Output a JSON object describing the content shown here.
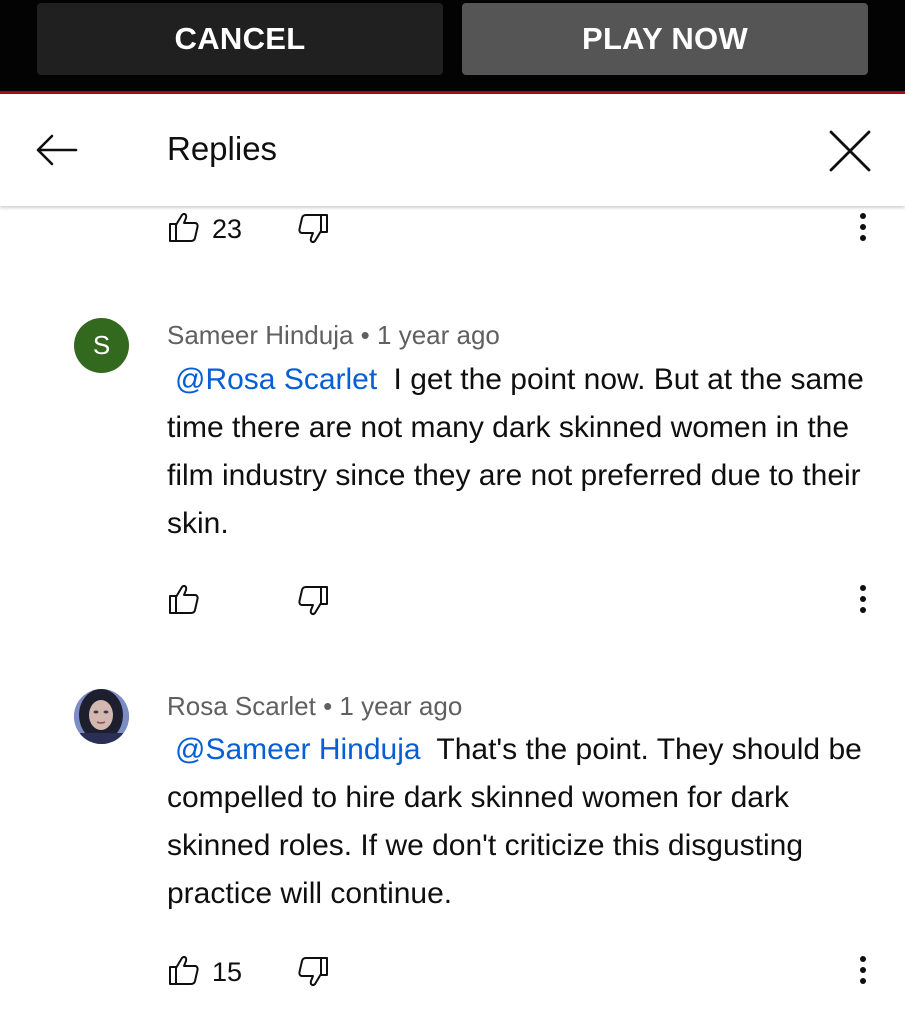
{
  "promo_bar": {
    "cancel_label": "CANCEL",
    "play_now_label": "PLAY NOW"
  },
  "header": {
    "title": "Replies"
  },
  "top_actions": {
    "like_count": "23"
  },
  "comments": [
    {
      "avatar_letter": "S",
      "author": "Sameer Hinduja",
      "time": "1 year ago",
      "separator": "•",
      "mention": "@Rosa Scarlet",
      "text": "I get the point now. But at the same time there are not many dark skinned women in the film industry since they are not preferred due to their skin.",
      "like_count": ""
    },
    {
      "avatar_letter": "",
      "author": "Rosa Scarlet",
      "time": "1 year ago",
      "separator": "•",
      "mention": "@Sameer Hinduja",
      "text": "That's the point. They should be compelled to hire dark skinned women for dark skinned roles. If we don't criticize this disgusting practice will continue.",
      "like_count": "15"
    }
  ],
  "colors": {
    "mention": "#065fd4",
    "avatar_s": "#33691e",
    "promo_bar": "#030303"
  }
}
